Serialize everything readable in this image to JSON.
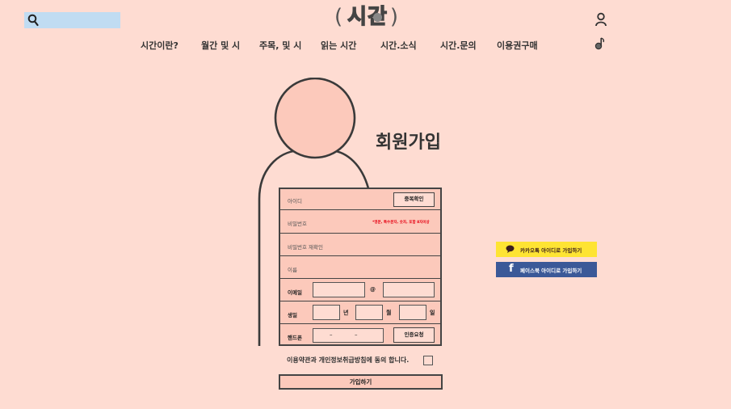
{
  "header": {
    "logo_text": "시간",
    "nav": [
      "시간이란?",
      "월간 및 시",
      "주목, 및 시",
      "읽는 시간",
      "시간.소식",
      "시간.문의",
      "이용권구매"
    ]
  },
  "main": {
    "title": "회원가입",
    "form": {
      "id_label": "아이디",
      "id_check_button": "중복확인",
      "password_label": "비밀번호",
      "password_hint": "*영문, 특수문자, 숫자, 포함 8자이상",
      "password_confirm_label": "비밀번호 재확인",
      "name_label": "이름",
      "email_label": "이메일",
      "email_at": "@",
      "birth_label": "생일",
      "year_unit": "년",
      "month_unit": "월",
      "day_unit": "일",
      "phone_label": "핸드폰",
      "phone_dash1": "–",
      "phone_dash2": "–",
      "verify_button": "인증요청"
    },
    "agree_text": "이용약관과 개인정보취급방침에 동의 합니다.",
    "submit_label": "가입하기"
  },
  "social": {
    "kakao_label": "카카오톡 아이디로 가입하기",
    "facebook_label": "페이스북 아이디로 가입하기",
    "facebook_glyph": "f"
  },
  "colors": {
    "background": "#fedcd2",
    "form_fill": "#fcc9bb",
    "search_fill": "#c0dcf2",
    "kakao": "#fee433",
    "facebook": "#3b5998",
    "hint_red": "#e60012"
  }
}
